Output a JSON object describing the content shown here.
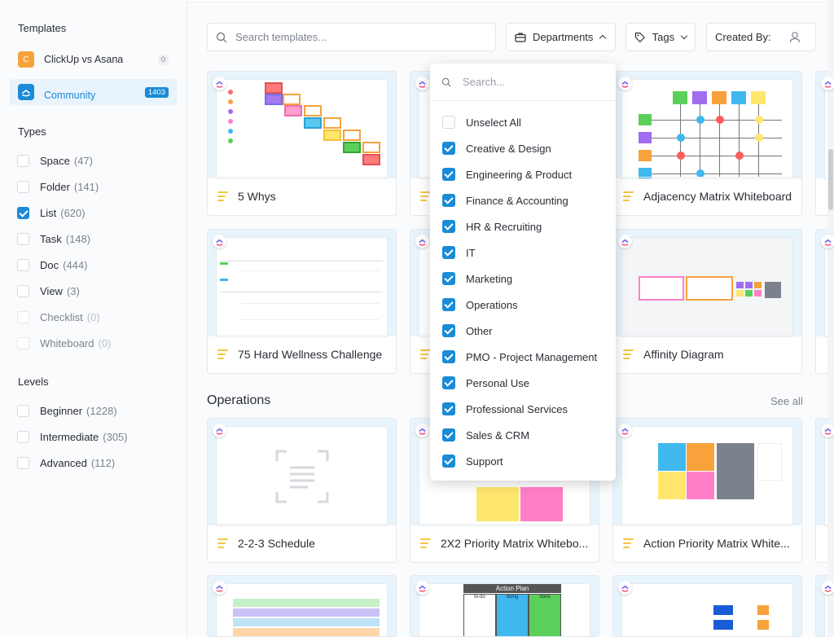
{
  "sidebar": {
    "templates_title": "Templates",
    "templates": [
      {
        "label": "ClickUp vs Asana",
        "count": "0",
        "icon": "C"
      },
      {
        "label": "Community",
        "count": "1403",
        "icon": "clickup-logo"
      }
    ],
    "types_title": "Types",
    "types": [
      {
        "label": "Space",
        "count": "(47)",
        "checked": false
      },
      {
        "label": "Folder",
        "count": "(141)",
        "checked": false
      },
      {
        "label": "List",
        "count": "(620)",
        "checked": true
      },
      {
        "label": "Task",
        "count": "(148)",
        "checked": false
      },
      {
        "label": "Doc",
        "count": "(444)",
        "checked": false
      },
      {
        "label": "View",
        "count": "(3)",
        "checked": false
      },
      {
        "label": "Checklist",
        "count": "(0)",
        "checked": false
      },
      {
        "label": "Whiteboard",
        "count": "(0)",
        "checked": false
      }
    ],
    "levels_title": "Levels",
    "levels": [
      {
        "label": "Beginner",
        "count": "(1228)"
      },
      {
        "label": "Intermediate",
        "count": "(305)"
      },
      {
        "label": "Advanced",
        "count": "(112)"
      }
    ]
  },
  "toolbar": {
    "search_placeholder": "Search templates...",
    "departments_label": "Departments",
    "tags_label": "Tags",
    "created_by_label": "Created By:"
  },
  "cards_row1": [
    "5 Whys",
    "",
    "Adjacency Matrix Whiteboard"
  ],
  "cards_row2": [
    "75 Hard Wellness Challenge",
    "",
    "Affinity Diagram"
  ],
  "section": {
    "title": "Operations",
    "see_all": "See all"
  },
  "cards_row3": [
    "2-2-3 Schedule",
    "2X2 Priority Matrix Whitebo...",
    "Action Priority Matrix White..."
  ],
  "thumb_text": {
    "action_plan": "Action Plan",
    "to_do": "to-do",
    "doing": "doing",
    "done": "done"
  },
  "dropdown": {
    "search_placeholder": "Search...",
    "items": [
      {
        "label": "Unselect All",
        "checked": false
      },
      {
        "label": "Creative & Design",
        "checked": true
      },
      {
        "label": "Engineering & Product",
        "checked": true
      },
      {
        "label": "Finance & Accounting",
        "checked": true
      },
      {
        "label": "HR & Recruiting",
        "checked": true
      },
      {
        "label": "IT",
        "checked": true
      },
      {
        "label": "Marketing",
        "checked": true
      },
      {
        "label": "Operations",
        "checked": true
      },
      {
        "label": "Other",
        "checked": true
      },
      {
        "label": "PMO - Project Management",
        "checked": true
      },
      {
        "label": "Personal Use",
        "checked": true
      },
      {
        "label": "Professional Services",
        "checked": true
      },
      {
        "label": "Sales & CRM",
        "checked": true
      },
      {
        "label": "Support",
        "checked": true
      }
    ]
  },
  "colors": {
    "accent": "#1a8bd6",
    "clickup_orange": "#f7a23b",
    "doc_yellow": "#f5c542"
  }
}
